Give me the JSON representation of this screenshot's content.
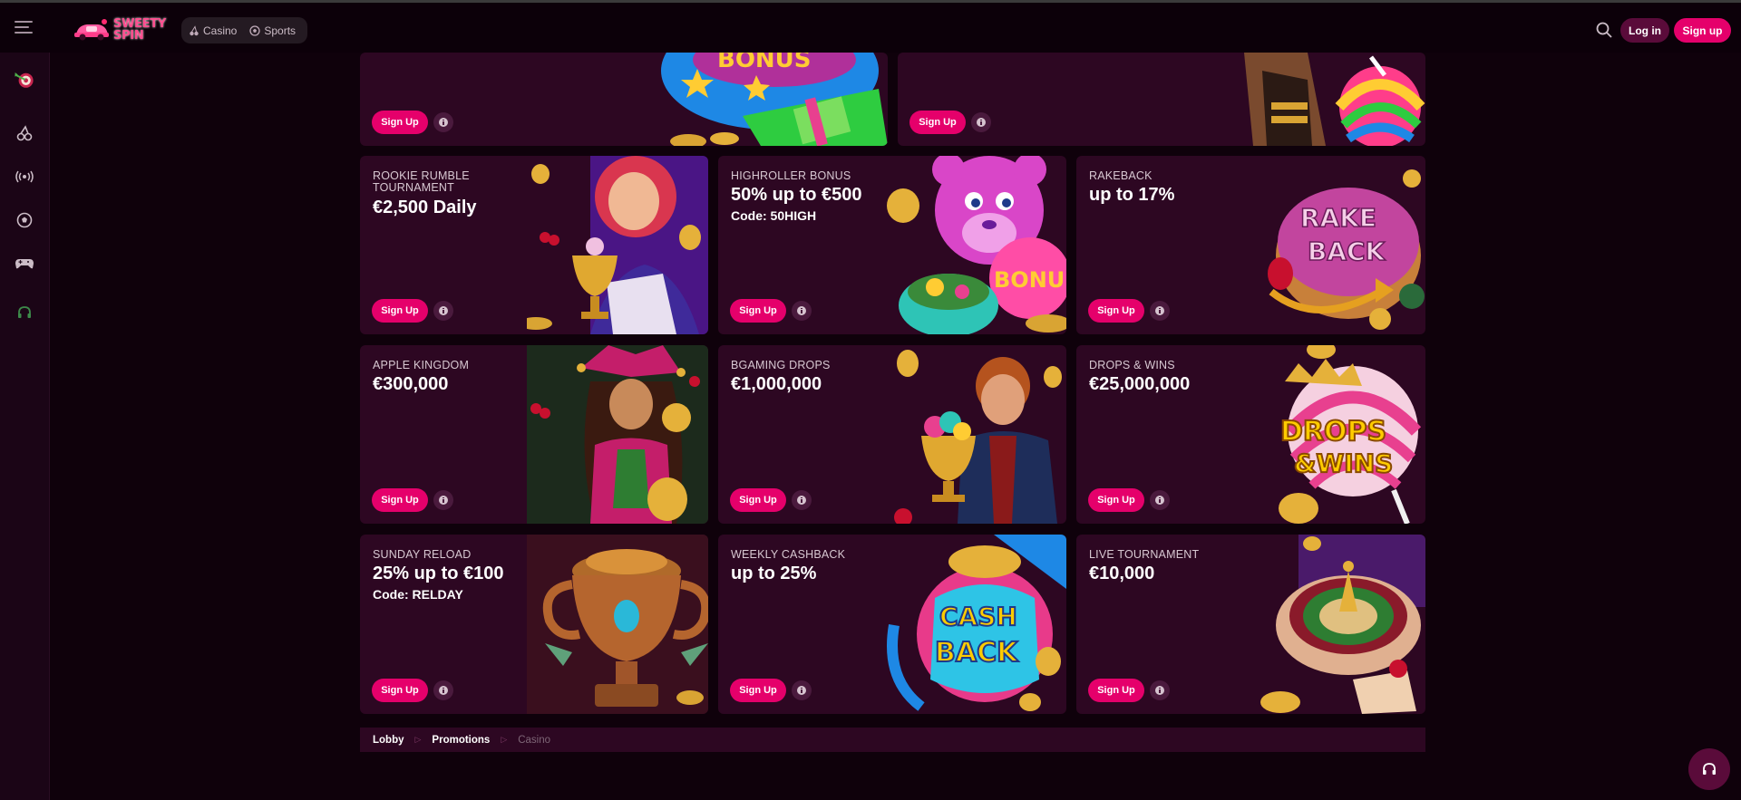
{
  "header": {
    "logo_line1": "SWEETY",
    "logo_line2": "SPIN",
    "nav": [
      {
        "label": "Casino",
        "icon": "cherry-icon"
      },
      {
        "label": "Sports",
        "icon": "soccer-ball-icon"
      }
    ],
    "login_label": "Log in",
    "signup_label": "Sign up"
  },
  "sidebar": {
    "icons": [
      "promotions-target-icon",
      "cherry-icon",
      "live-broadcast-icon",
      "soccer-ball-icon",
      "gamepad-icon",
      "headset-icon"
    ]
  },
  "promos": {
    "top_row": [
      {
        "signup_label": "Sign Up"
      },
      {
        "signup_label": "Sign Up"
      }
    ],
    "cards": [
      {
        "label": "ROOKIE RUMBLE TOURNAMENT",
        "value": "€2,500 Daily",
        "code": "",
        "signup_label": "Sign Up",
        "art": "girl-with-trophy"
      },
      {
        "label": "HIGHROLLER BONUS",
        "value": "50% up to €500",
        "code": "Code: 50HIGH",
        "signup_label": "Sign Up",
        "art": "pink-bear-bonus"
      },
      {
        "label": "RAKEBACK",
        "value": "up to 17%",
        "code": "",
        "signup_label": "Sign Up",
        "art": "rake-back-donut"
      },
      {
        "label": "APPLE KINGDOM",
        "value": "€300,000",
        "code": "",
        "signup_label": "Sign Up",
        "art": "jester-girl"
      },
      {
        "label": "BGAMING DROPS",
        "value": "€1,000,000",
        "code": "",
        "signup_label": "Sign Up",
        "art": "man-with-candy-cup"
      },
      {
        "label": "DROPS & WINS",
        "value": "€25,000,000",
        "code": "",
        "signup_label": "Sign Up",
        "art": "drops-wins-lollipop"
      },
      {
        "label": "SUNDAY RELOAD",
        "value": "25% up to €100",
        "code": "Code: RELDAY",
        "signup_label": "Sign Up",
        "art": "bronze-trophy"
      },
      {
        "label": "WEEKLY CASHBACK",
        "value": "up to 25%",
        "code": "",
        "signup_label": "Sign Up",
        "art": "cash-back-jar"
      },
      {
        "label": "LIVE TOURNAMENT",
        "value": "€10,000",
        "code": "",
        "signup_label": "Sign Up",
        "art": "roulette-cake"
      }
    ]
  },
  "breadcrumb": [
    "Lobby",
    "Promotions",
    "Casino"
  ],
  "colors": {
    "background": "#0f010b",
    "card": "#2d0722",
    "accent": "#e5006b",
    "sidebar": "#1b0516"
  }
}
